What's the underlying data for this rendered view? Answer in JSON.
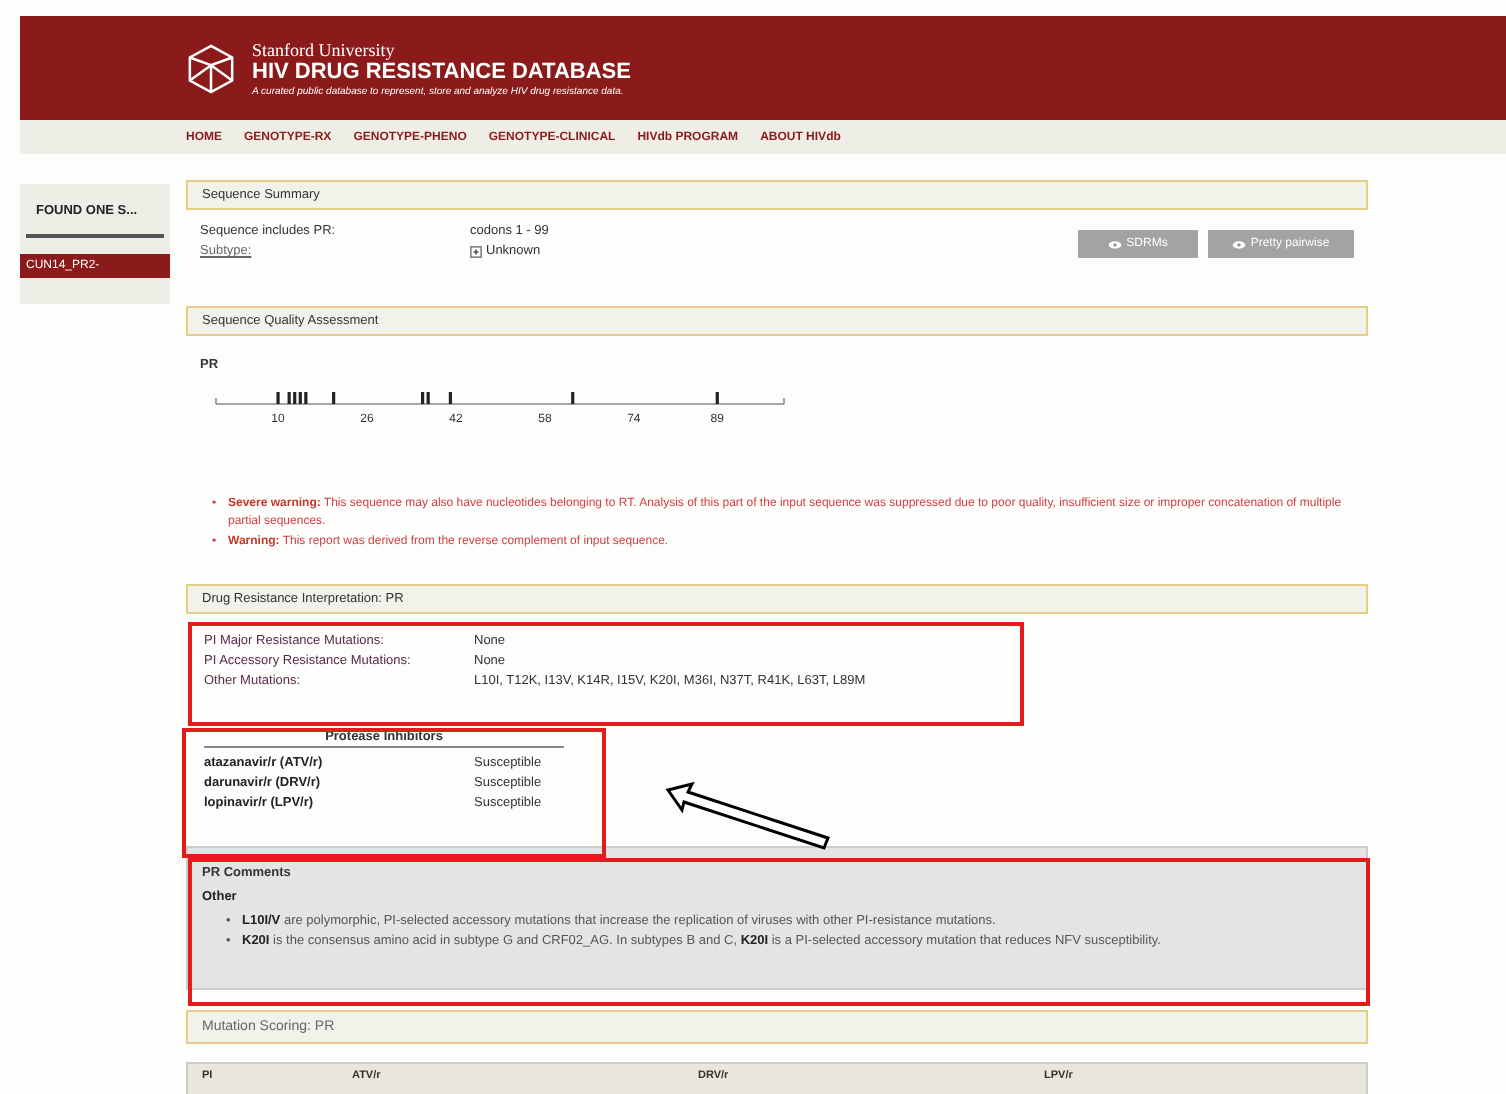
{
  "header": {
    "university": "Stanford University",
    "title": "HIV DRUG RESISTANCE DATABASE",
    "tagline": "A curated public database to represent, store and analyze HIV drug resistance data."
  },
  "nav": [
    "HOME",
    "GENOTYPE-RX",
    "GENOTYPE-PHENO",
    "GENOTYPE-CLINICAL",
    "HIVdb PROGRAM",
    "ABOUT HIVdb"
  ],
  "sidebar": {
    "heading": "FOUND ONE S...",
    "items": [
      {
        "label": "CUN14_PR2-",
        "selected": true
      }
    ]
  },
  "summary": {
    "title": "Sequence Summary",
    "rows": [
      {
        "label": "Sequence includes PR:",
        "value": "codons 1 - 99",
        "kind": "plain"
      },
      {
        "label": "Subtype:",
        "value": "Unknown",
        "kind": "expandable"
      }
    ],
    "buttons": [
      "SDRMs",
      "Pretty pairwise"
    ]
  },
  "quality": {
    "title": "Sequence Quality Assessment",
    "gene": "PR",
    "ticks": [
      "10",
      "26",
      "42",
      "58",
      "74",
      "89"
    ],
    "warnings": [
      {
        "bullet": "•",
        "lead": "Severe warning:",
        "text": "This sequence may also have nucleotides belonging to RT. Analysis of this part of the input sequence was suppressed due to poor quality, insufficient size or improper concatenation of multiple partial sequences."
      },
      {
        "bullet": "•",
        "lead": "Warning:",
        "text": "This report was derived from the reverse complement of input sequence."
      }
    ]
  },
  "interpretation": {
    "title": "Drug Resistance Interpretation: PR",
    "rows": [
      {
        "label": "PI Major Resistance Mutations:",
        "value": "None"
      },
      {
        "label": "PI Accessory Resistance Mutations:",
        "value": "None"
      },
      {
        "label": "Other Mutations:",
        "value": "L10I, T12K, I13V, K14R, I15V, K20I, M36I, N37T, R41K, L63T, L89M"
      }
    ],
    "drug_heading": "Protease Inhibitors",
    "drugs": [
      {
        "name": "atazanavir/r (ATV/r)",
        "result": "Susceptible"
      },
      {
        "name": "darunavir/r (DRV/r)",
        "result": "Susceptible"
      },
      {
        "name": "lopinavir/r (LPV/r)",
        "result": "Susceptible"
      }
    ]
  },
  "comments": {
    "title": "PR Comments",
    "subtitle": "Other",
    "items": [
      {
        "bullet": "•",
        "text": "**L10I/V** are polymorphic, PI-selected accessory mutations that increase the replication of viruses with other PI-resistance mutations."
      },
      {
        "bullet": "•",
        "text": "**K20I** is the consensus amino acid in subtype G and CRF02_AG. In subtypes B and C, **K20I** is a PI-selected accessory mutation that reduces NFV susceptibility."
      }
    ]
  },
  "scoring": {
    "title": "Mutation Scoring: PR",
    "columns": [
      "PI",
      "ATV/r",
      "DRV/r",
      "LPV/r"
    ]
  }
}
